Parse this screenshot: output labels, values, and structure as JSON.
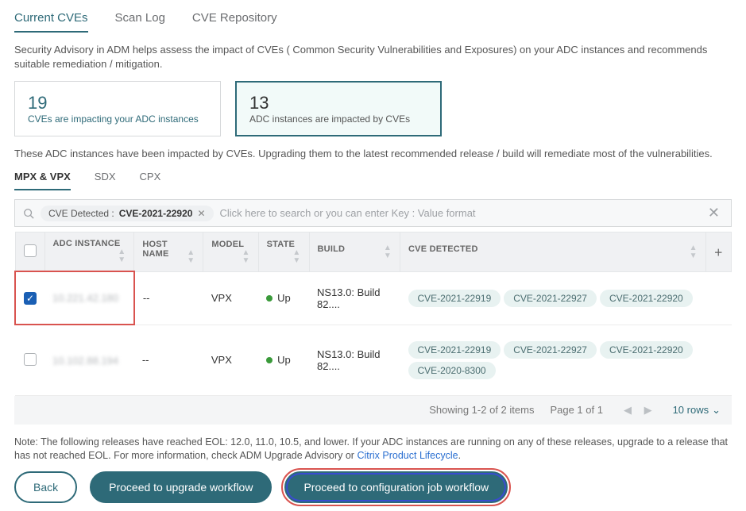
{
  "tabs": {
    "main": [
      "Current CVEs",
      "Scan Log",
      "CVE Repository"
    ],
    "main_active": 0,
    "sub": [
      "MPX & VPX",
      "SDX",
      "CPX"
    ],
    "sub_active": 0
  },
  "description": "Security Advisory in ADM helps assess the impact of CVEs ( Common Security Vulnerabilities and Exposures) on your ADC instances and recommends suitable remediation / mitigation.",
  "cards": {
    "cves": {
      "num": "19",
      "sub": "CVEs are impacting your ADC instances"
    },
    "instances": {
      "num": "13",
      "sub": "ADC instances are impacted by CVEs"
    }
  },
  "impact_note": "These ADC instances have been impacted by CVEs. Upgrading them to the latest recommended release / build will remediate most of the vulnerabilities.",
  "search": {
    "chip_key": "CVE Detected :",
    "chip_val": "CVE-2021-22920",
    "placeholder": "Click here to search or you can enter Key : Value format"
  },
  "table": {
    "headers": [
      "ADC INSTANCE",
      "HOST NAME",
      "MODEL",
      "STATE",
      "BUILD",
      "CVE DETECTED"
    ],
    "rows": [
      {
        "checked": true,
        "highlight_adc_cell": true,
        "adc": "10.221.42.180",
        "host": "--",
        "model": "VPX",
        "state": "Up",
        "build": "NS13.0: Build 82....",
        "cves": [
          "CVE-2021-22919",
          "CVE-2021-22927",
          "CVE-2021-22920"
        ]
      },
      {
        "checked": false,
        "highlight_adc_cell": false,
        "adc": "10.102.88.194",
        "host": "--",
        "model": "VPX",
        "state": "Up",
        "build": "NS13.0: Build 82....",
        "cves": [
          "CVE-2021-22919",
          "CVE-2021-22927",
          "CVE-2021-22920",
          "CVE-2020-8300"
        ]
      }
    ]
  },
  "pager": {
    "showing": "Showing 1-2 of 2 items",
    "page": "Page 1 of 1",
    "rows": "10 rows"
  },
  "eol_note": {
    "prefix": "Note: The following releases have reached EOL: 12.0, 11.0, 10.5, and lower. If your ADC instances are running on any of these releases, upgrade to a release that has not reached EOL. For more information, check ADM Upgrade Advisory or ",
    "link": "Citrix Product Lifecycle",
    "suffix": "."
  },
  "buttons": {
    "back": "Back",
    "upgrade": "Proceed to upgrade workflow",
    "config": "Proceed to configuration job workflow"
  }
}
